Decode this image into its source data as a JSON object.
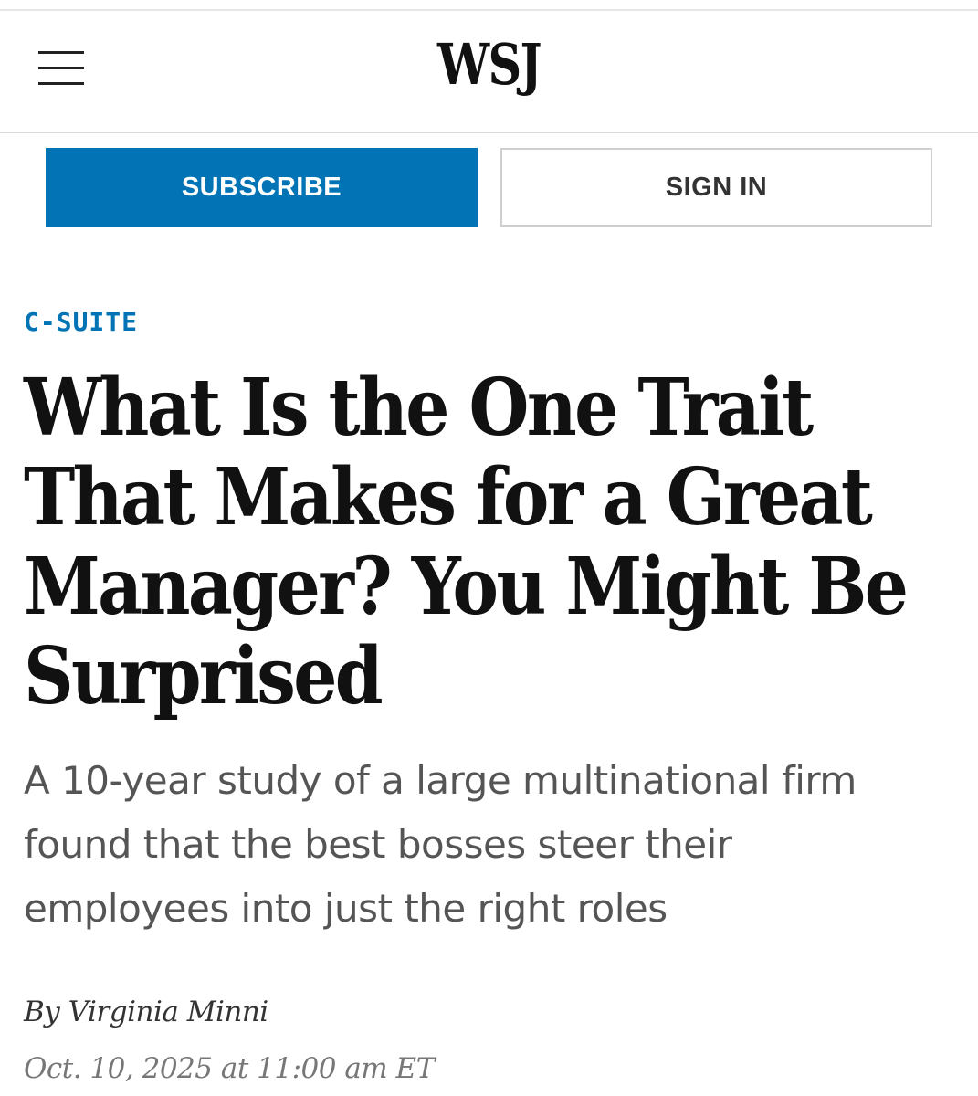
{
  "header": {
    "logo": "WSJ",
    "menu_icon": "hamburger-menu-icon"
  },
  "auth": {
    "subscribe_label": "SUBSCRIBE",
    "signin_label": "SIGN IN"
  },
  "article": {
    "section": "C-SUITE",
    "headline_lines": [
      "What Is the One Trait",
      "That Makes for a Great",
      "Manager? You Might Be",
      "Surprised"
    ],
    "dek_lines": [
      "A 10-year study of a large multinational firm",
      "found that the best bosses steer their",
      "employees into just the right roles"
    ],
    "byline_prefix": "By",
    "author": "Virginia Minni",
    "timestamp": "Oct. 10, 2025 at 11:00 am ET"
  },
  "colors": {
    "accent": "#0274b6",
    "text": "#111111",
    "dek": "#555555",
    "timestamp": "#777777"
  }
}
